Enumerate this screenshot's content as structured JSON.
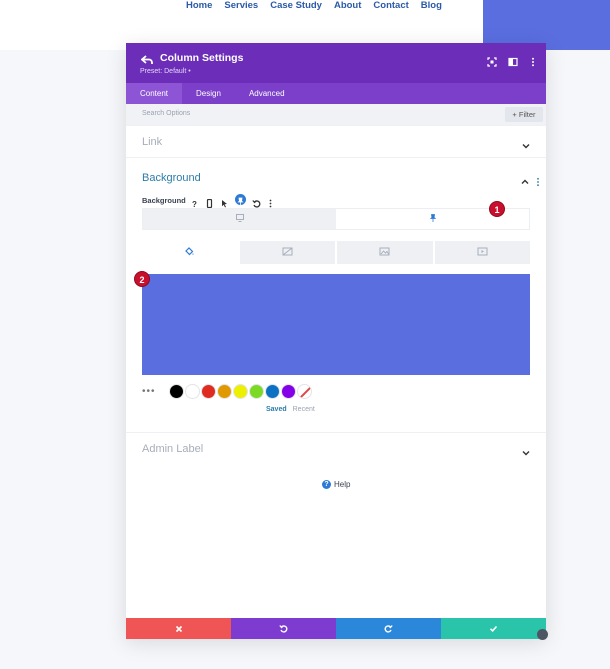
{
  "site_nav": [
    "Home",
    "Servies",
    "Case Study",
    "About",
    "Contact",
    "Blog"
  ],
  "modal": {
    "title": "Column Settings",
    "preset": "Preset: Default •",
    "tabs": [
      "Content",
      "Design",
      "Advanced"
    ],
    "active_tab": "Content",
    "search_placeholder": "Search Options",
    "filter_label": "+ Filter",
    "sections": {
      "link": "Link",
      "background": "Background",
      "admin_label": "Admin Label"
    },
    "background_row_label": "Background",
    "background_color": "#5a6ee0",
    "swatch_more": "•••",
    "swatches": [
      "#000000",
      "#ffffff",
      "#e02b20",
      "#e09900",
      "#edf000",
      "#7cda24",
      "#0c71c3",
      "#8300e9"
    ],
    "saved_label": "Saved",
    "recent_label": "Recent",
    "help_label": "Help"
  },
  "badges": [
    "1",
    "2"
  ],
  "colors": {
    "header": "#6c2eb9",
    "tabs_bar": "#7b3fc9",
    "cancel": "#ef5555",
    "undo": "#7e3bd0",
    "redo": "#2b87da",
    "save": "#29c4a9",
    "accent_text": "#2d7ca8"
  },
  "icons": [
    "back-arrow-icon",
    "fullscreen-icon",
    "split-view-icon",
    "more-vertical-icon",
    "chevron-down-icon",
    "chevron-up-icon",
    "help-icon",
    "phone-icon",
    "pointer-icon",
    "pin-icon",
    "undo-icon",
    "desktop-icon",
    "paint-bucket-icon",
    "gradient-icon",
    "image-icon",
    "video-icon",
    "close-icon",
    "redo-icon",
    "check-icon"
  ]
}
